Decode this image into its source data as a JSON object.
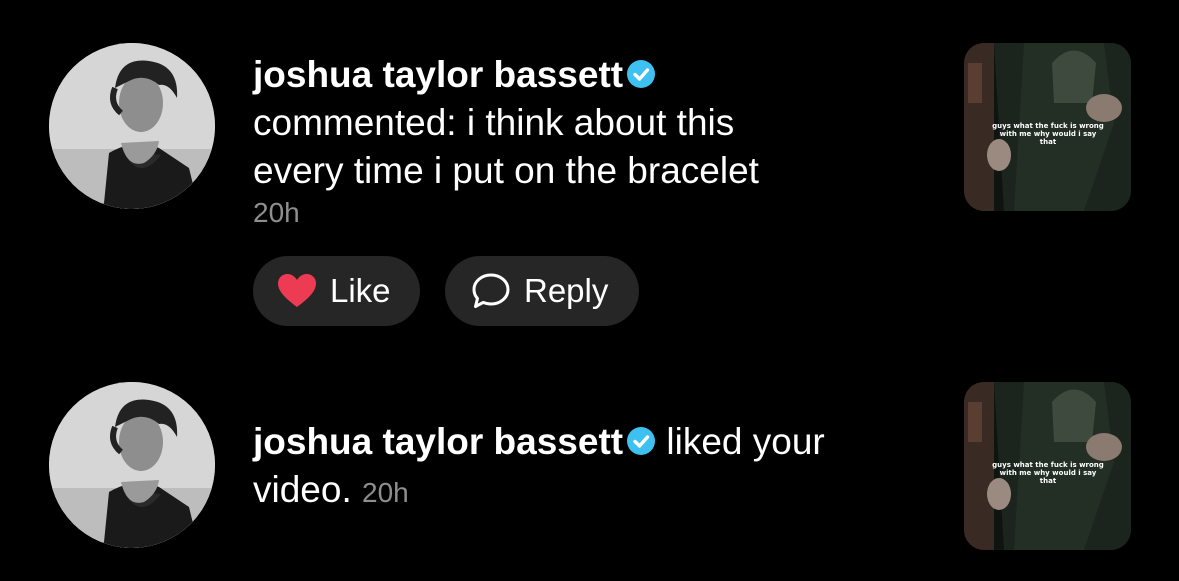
{
  "notifications": [
    {
      "username": "joshua taylor bassett",
      "comment_line1": "commented: i think about this",
      "comment_line2": "every time i put on the bracelet",
      "time": "20h",
      "like_label": "Like",
      "reply_label": "Reply",
      "thumbnail_caption": "guys what the fuck is wrong with me why would i say that"
    },
    {
      "username": "joshua taylor bassett",
      "action_part1": " liked your",
      "action_part2": "video.",
      "time": "20h",
      "thumbnail_caption": "guys what the fuck is wrong with me why would i say that"
    }
  ],
  "colors": {
    "background": "#000000",
    "verified": "#3ec0f0",
    "like_heart": "#ee3b54",
    "pill_bg": "#262626",
    "secondary_text": "#8e8e8e"
  },
  "icons": {
    "verified": "verified-badge-icon",
    "like": "heart-icon",
    "reply": "speech-bubble-icon"
  }
}
